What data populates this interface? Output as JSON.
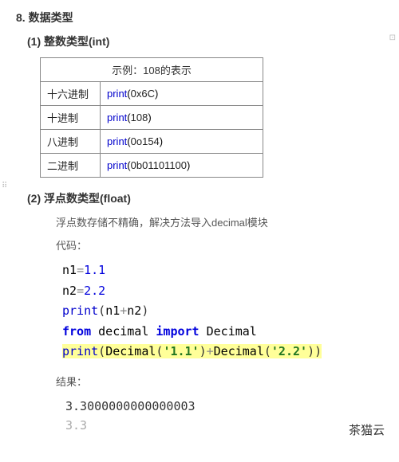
{
  "section": {
    "number": "8.",
    "title": "数据类型"
  },
  "sub1": {
    "title": "(1) 整数类型(int)"
  },
  "table": {
    "header": "示例：108的表示",
    "rows": [
      {
        "label": "十六进制",
        "func": "print",
        "arg": "0x6C"
      },
      {
        "label": "十进制",
        "func": "print",
        "arg": "108"
      },
      {
        "label": "八进制",
        "func": "print",
        "arg": "0o154"
      },
      {
        "label": "二进制",
        "func": "print",
        "arg": "0b01101100"
      }
    ]
  },
  "sub2": {
    "title": "(2) 浮点数类型(float)"
  },
  "desc_float": "浮点数存储不精确，解决方法导入decimal模块",
  "code_label": "代码：",
  "code": {
    "l1_var": "n1",
    "l1_eq": "=",
    "l1_val": "1.1",
    "l2_var": "n2",
    "l2_eq": "=",
    "l2_val": "2.2",
    "l3_fn": "print",
    "l3_arg1": "n1",
    "l3_op": "+",
    "l3_arg2": "n2",
    "l4_from": "from",
    "l4_mod": "decimal",
    "l4_import": "import",
    "l4_cls": "Decimal",
    "l5_fn": "print",
    "l5_cls": "Decimal",
    "l5_str1": "'1.1'",
    "l5_plus": "+",
    "l5_str2": "'2.2'"
  },
  "result_label": "结果：",
  "output": {
    "line1": "3.3000000000000003",
    "line2": "3.3"
  },
  "watermark": "茶猫云"
}
